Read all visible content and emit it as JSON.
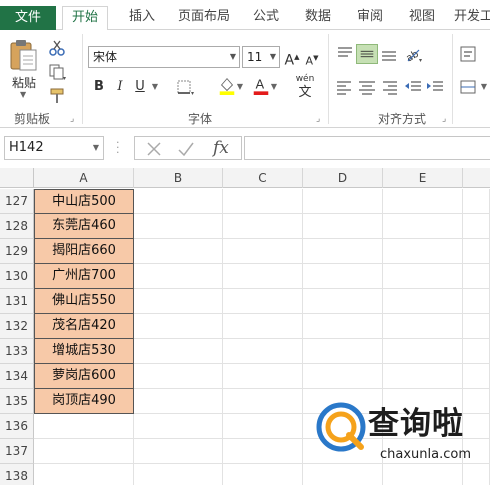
{
  "tabs": [
    {
      "id": "file",
      "label": "文件"
    },
    {
      "id": "home",
      "label": "开始"
    },
    {
      "id": "insert",
      "label": "插入"
    },
    {
      "id": "layout",
      "label": "页面布局"
    },
    {
      "id": "formulas",
      "label": "公式"
    },
    {
      "id": "data",
      "label": "数据"
    },
    {
      "id": "review",
      "label": "审阅"
    },
    {
      "id": "view",
      "label": "视图"
    },
    {
      "id": "developer",
      "label": "开发工"
    }
  ],
  "clipboard": {
    "paste_label": "粘贴",
    "group_label": "剪贴板"
  },
  "font": {
    "family_value": "宋体",
    "size_value": "11",
    "bold": "B",
    "italic": "I",
    "underline": "U",
    "grow": "A",
    "shrink": "A",
    "font_color_letter": "A",
    "phonetic": "wén",
    "group_label": "字体"
  },
  "alignment": {
    "group_label": "对齐方式"
  },
  "formula_bar": {
    "name_box": "H142",
    "fx": "fx",
    "formula": ""
  },
  "grid": {
    "columns": [
      "A",
      "B",
      "C",
      "D",
      "E"
    ],
    "rows": [
      {
        "num": "127",
        "a": "中山店500"
      },
      {
        "num": "128",
        "a": "东莞店460"
      },
      {
        "num": "129",
        "a": "揭阳店660"
      },
      {
        "num": "130",
        "a": "广州店700"
      },
      {
        "num": "131",
        "a": "佛山店550"
      },
      {
        "num": "132",
        "a": "茂名店420"
      },
      {
        "num": "133",
        "a": "增城店530"
      },
      {
        "num": "134",
        "a": "萝岗店600"
      },
      {
        "num": "135",
        "a": "岗顶店490"
      },
      {
        "num": "136",
        "a": ""
      },
      {
        "num": "137",
        "a": ""
      },
      {
        "num": "138",
        "a": ""
      }
    ]
  },
  "watermark": {
    "logo_text": "查询啦",
    "url": "chaxunla.com"
  },
  "colors": {
    "excel_green": "#217346",
    "cell_fill": "#f7c9a8",
    "font_color_bar": "#e31b1b",
    "highlight_bar": "#ffff00"
  },
  "icons": [
    "cut-icon",
    "copy-icon",
    "format-painter-icon",
    "borders-icon",
    "fill-color-icon",
    "font-color-icon",
    "align-top-icon",
    "align-middle-icon",
    "align-bottom-icon",
    "orientation-icon",
    "align-left-icon",
    "align-center-icon",
    "align-right-icon",
    "decrease-indent-icon",
    "increase-indent-icon",
    "wrap-text-icon",
    "merge-icon",
    "cancel-icon",
    "enter-icon",
    "function-icon"
  ]
}
